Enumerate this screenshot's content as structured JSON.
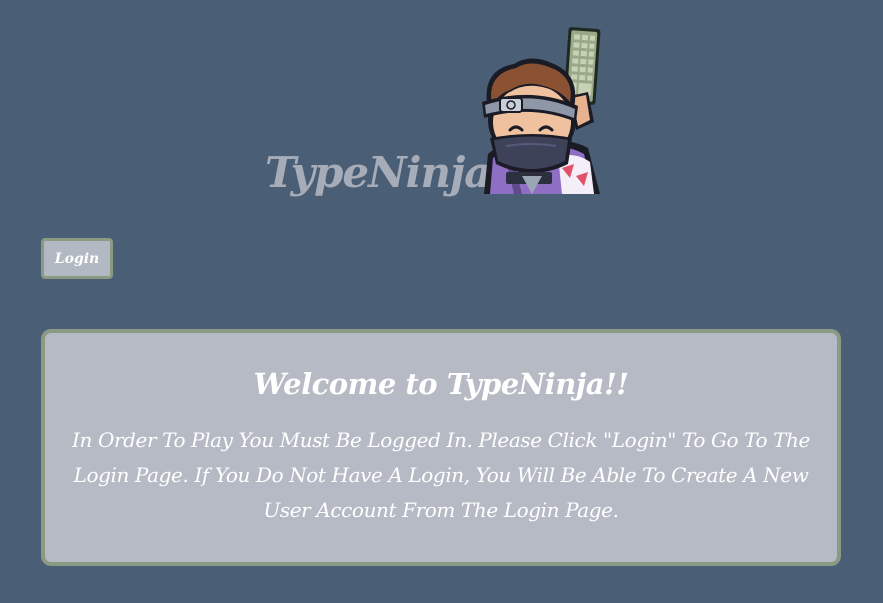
{
  "header": {
    "brand_title": "TypeNinja",
    "mascot_icon": "ninja-holding-keyboard-mascot"
  },
  "nav": {
    "login_label": "Login"
  },
  "welcome": {
    "heading": "Welcome to TypeNinja!!",
    "body": "In Order To Play You Must Be Logged In. Please Click \"Login\" To Go To The Login Page. If You Do Not Have A Login, You Will Be Able To Create A New User Account From The Login Page."
  },
  "colors": {
    "background": "#4a5e76",
    "card": "#b5bac4",
    "border": "#8b9a83",
    "title": "#a7adb8",
    "text": "#ffffff"
  }
}
